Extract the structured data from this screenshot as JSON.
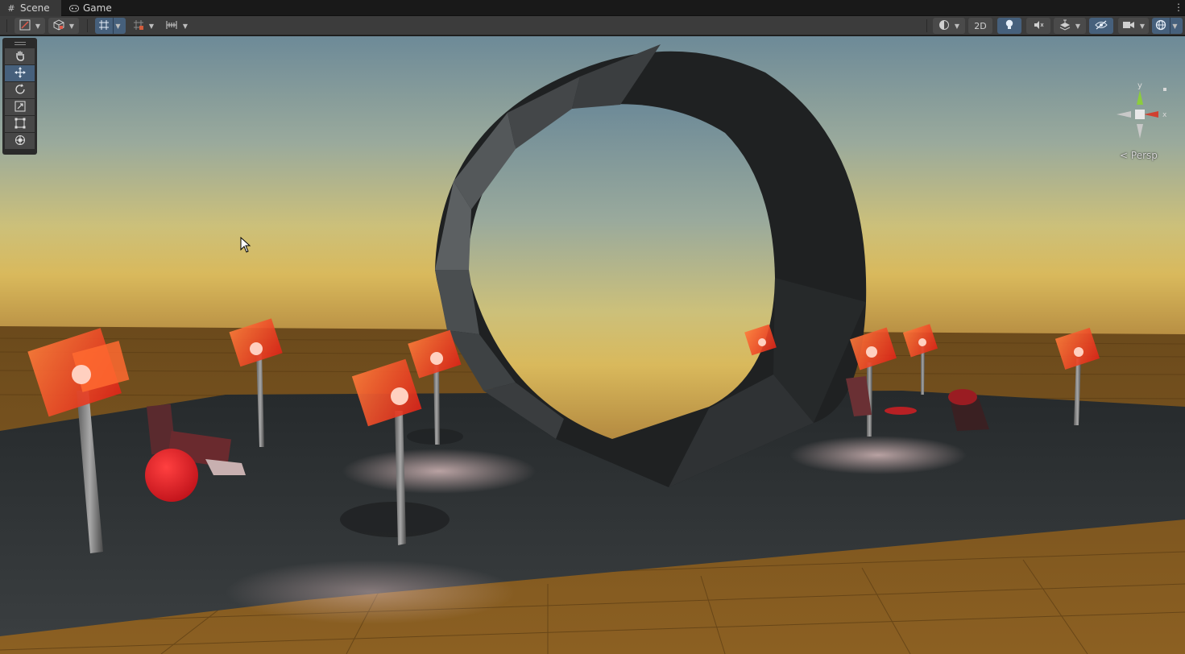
{
  "tabs": [
    {
      "label": "Scene",
      "icon": "grid-hash-icon",
      "active": true
    },
    {
      "label": "Game",
      "icon": "gamepad-icon",
      "active": false
    }
  ],
  "tab_menu_icon": "more-vertical-icon",
  "toolbar": {
    "left": [
      {
        "name": "draw-mode",
        "icon": "draw-mode-icon"
      },
      {
        "name": "shading-mode",
        "icon": "cube-icon"
      },
      {
        "name": "grid-snap",
        "icon": "grid-snap-icon",
        "on": true
      },
      {
        "name": "increment-snap",
        "icon": "increment-snap-icon"
      },
      {
        "name": "ruler",
        "icon": "ruler-icon"
      }
    ],
    "two_d_label": "2D",
    "right": [
      {
        "name": "render-mode",
        "icon": "sphere-shading-icon"
      },
      {
        "name": "lighting",
        "icon": "light-bulb-icon",
        "on": true
      },
      {
        "name": "audio",
        "icon": "mute-speaker-icon"
      },
      {
        "name": "effects",
        "icon": "effects-layers-icon"
      },
      {
        "name": "scene-visibility",
        "icon": "eye-hidden-icon",
        "on": true
      },
      {
        "name": "camera",
        "icon": "camera-icon"
      },
      {
        "name": "gizmos",
        "icon": "gizmo-globe-icon",
        "on": true
      }
    ]
  },
  "tools": [
    {
      "name": "hand-tool",
      "icon": "hand-icon",
      "selected": false
    },
    {
      "name": "move-tool",
      "icon": "move-arrows-icon",
      "selected": true
    },
    {
      "name": "rotate-tool",
      "icon": "rotate-icon",
      "selected": false
    },
    {
      "name": "scale-tool",
      "icon": "scale-icon",
      "selected": false
    },
    {
      "name": "rect-tool",
      "icon": "rect-transform-icon",
      "selected": false
    },
    {
      "name": "transform-tool",
      "icon": "transform-icon",
      "selected": false
    }
  ],
  "gizmo": {
    "y_label": "y",
    "x_label": "x",
    "projection_label": "Persp"
  },
  "colors": {
    "accent": "#46607c",
    "sky_top": "#6e8c9a",
    "sky_horizon": "#d7c06e",
    "ground": "#8a6020",
    "platform": "#2e3234",
    "ring": "#2a2c2d",
    "gizmo_x": "#e04a3a",
    "gizmo_y": "#8ccd3c",
    "light_icon": "#e8452a",
    "sphere": "#e01e24"
  }
}
